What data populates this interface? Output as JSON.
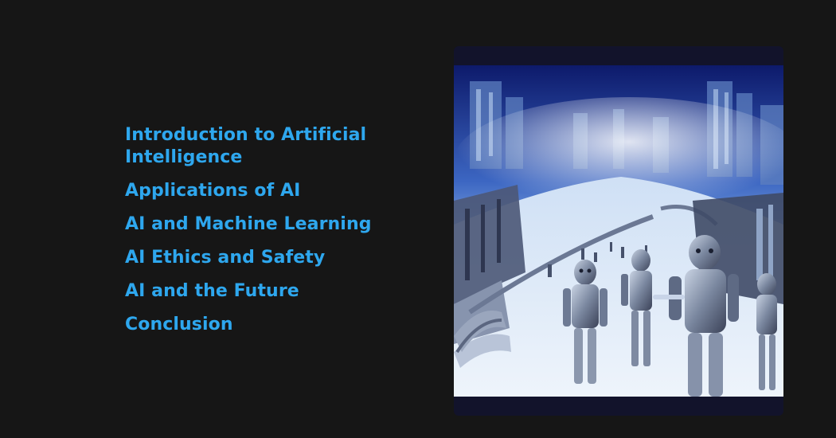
{
  "toc": {
    "items": [
      {
        "label": "Introduction to Artificial Intelligence"
      },
      {
        "label": "Applications of AI"
      },
      {
        "label": "AI and Machine Learning"
      },
      {
        "label": "AI Ethics and Safety"
      },
      {
        "label": "AI and the Future"
      },
      {
        "label": "Conclusion"
      }
    ]
  },
  "illustration": {
    "subject": "futuristic-city-with-robots",
    "colors": {
      "sky_top": "#0d1a6b",
      "sky_haze": "#9fc6f2",
      "ground": "#dfeaf8",
      "metal": "#8c9bb4",
      "frame": "#12132b"
    }
  },
  "colors": {
    "background": "#161616",
    "link": "#2ea7ee"
  }
}
